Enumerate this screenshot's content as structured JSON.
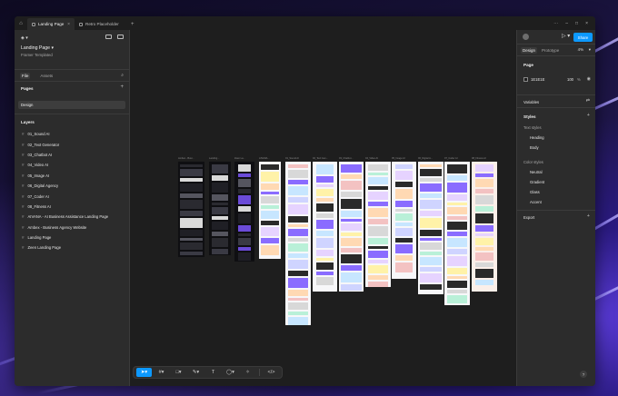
{
  "titlebar": {
    "tabs": [
      {
        "label": "Landing Page",
        "active": true
      },
      {
        "label": "Retro Placeholder",
        "active": false
      }
    ]
  },
  "left_panel": {
    "file_title": "Landing Page",
    "file_subtitle": "Framer Templated",
    "tabs": [
      "File",
      "Assets"
    ],
    "pages_title": "Pages",
    "pages": [
      "Design"
    ],
    "layers_title": "Layers",
    "layers": [
      "01_Sound AI",
      "02_Text Generator",
      "03_Chatbot AI",
      "04_Video AI",
      "05_Image AI",
      "06_Digital Agency",
      "07_Coder AI",
      "08_Fitness AI",
      "AIVANA - AI Business Assistance Landing Page",
      "Ambex - Business Agency Website",
      "Landing Page",
      "Zeen Landing Page"
    ]
  },
  "right_panel": {
    "share_label": "Share",
    "tabs": [
      "Design",
      "Prototype"
    ],
    "zoom": "4%",
    "page_title": "Page",
    "page_color": "1E1E1E",
    "page_opacity": "100",
    "page_opacity_unit": "%",
    "variables_label": "Variables",
    "styles_title": "Styles",
    "text_styles_label": "Text styles",
    "text_styles": [
      "Heading",
      "Body"
    ],
    "color_styles_label": "Color styles",
    "color_styles": [
      "Neutral",
      "Gradient",
      "Glass",
      "Accent"
    ],
    "export_label": "Export"
  },
  "canvas": {
    "frame_labels": [
      "Ambex - Busi...",
      "Landing...",
      "Zeen La...",
      "AIVANA...",
      "01_Sound AI",
      "02_Text Gen...",
      "03_Chatbot...",
      "04_Video AI",
      "05_Image AI",
      "06_Digital A...",
      "07_Coder AI",
      "08_Fitness AI"
    ]
  },
  "toolbar": {
    "code_label": "</>"
  },
  "help_label": "?"
}
